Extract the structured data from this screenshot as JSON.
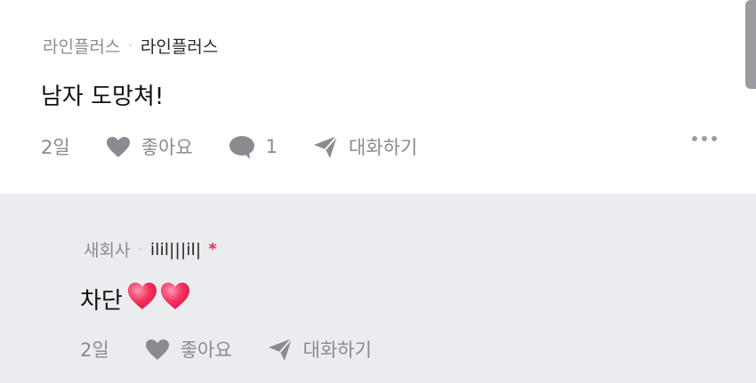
{
  "post": {
    "company": "라인플러스",
    "separator": "·",
    "nickname": "라인플러스",
    "content": "남자 도망쳐!",
    "time": "2일",
    "like_label": "좋아요",
    "comment_count": "1",
    "reply_label": "대화하기",
    "icons": {
      "like": "heart-icon",
      "comment": "speech-bubble-icon",
      "reply": "paper-plane-icon",
      "more": "more-dots-icon"
    }
  },
  "reply": {
    "company": "새회사",
    "separator": "·",
    "nickname": "ilil|||il|",
    "author_mark": "*",
    "content": "차단",
    "content_emoji": "heart-emoji x2",
    "time": "2일",
    "like_label": "좋아요",
    "reply_label": "대화하기",
    "icons": {
      "like": "heart-icon",
      "reply": "paper-plane-icon"
    }
  },
  "colors": {
    "reply_background": "#ebecf0",
    "muted_text": "#8a8a90",
    "author_mark": "#e0344f",
    "emoji_heart": "#f5335e"
  }
}
